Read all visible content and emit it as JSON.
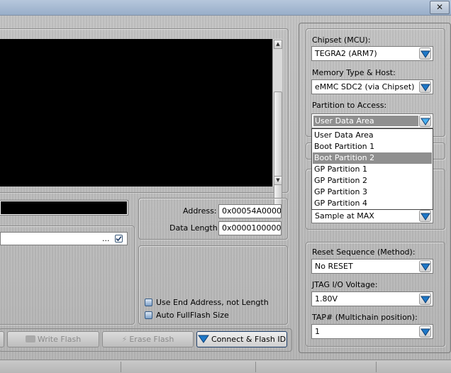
{
  "window": {
    "close_glyph": "✕"
  },
  "main": {
    "ellipsis": "..."
  },
  "address": {
    "address_label": "Address:",
    "address_value": "0x00054A0000",
    "length_label": "Data Length:",
    "length_value": "0x0000100000"
  },
  "options": {
    "use_end_address": "Use End Address, not Length",
    "auto_fullflash": "Auto FullFlash Size"
  },
  "toolbar": {
    "write_flash": "Write Flash",
    "erase_flash": "Erase Flash",
    "connect_flash_id": "Connect & Flash ID"
  },
  "sidebar": {
    "chipset_label": "Chipset (MCU):",
    "chipset_value": "TEGRA2 (ARM7)",
    "memory_label": "Memory Type & Host:",
    "memory_value": "eMMC SDC2 (via Chipset)",
    "partition_label": "Partition to Access:",
    "partition_value": "User Data Area",
    "partition_options": [
      "User Data Area",
      "Boot Partition 1",
      "Boot Partition 2",
      "GP Partition 1",
      "GP Partition 2",
      "GP Partition 3",
      "GP Partition 4"
    ],
    "partition_highlighted": "Boot Partition 2",
    "sample_value": "Sample at MAX",
    "reset_label": "Reset Sequence (Method):",
    "reset_value": "No RESET",
    "voltage_label": "JTAG I/O Voltage:",
    "voltage_value": "1.80V",
    "tap_label": "TAP# (Multichain position):",
    "tap_value": "1"
  },
  "colors": {
    "accent": "#1e78c8",
    "highlight": "#8f8f8f"
  }
}
